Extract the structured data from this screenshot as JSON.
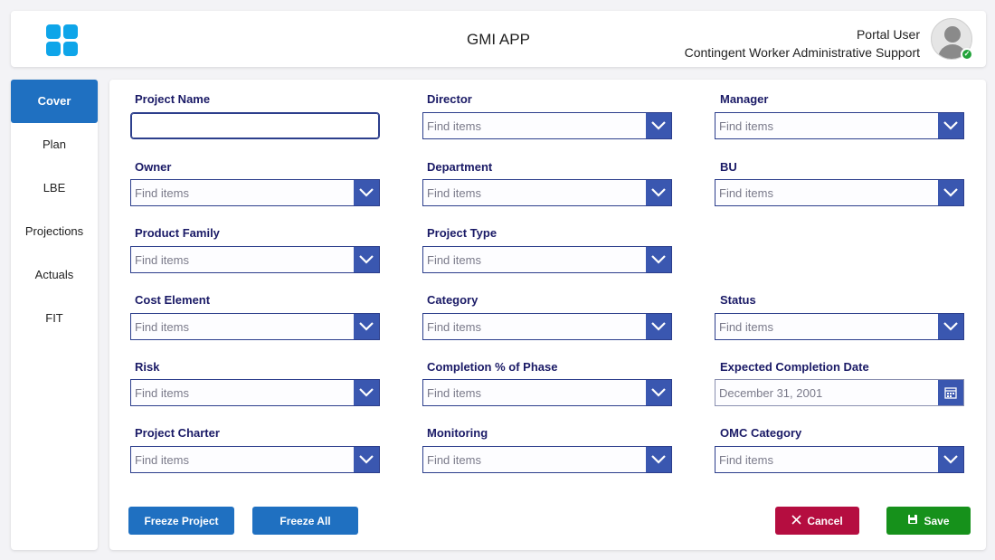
{
  "header": {
    "app_title": "GMI APP",
    "user_name": "Portal User",
    "user_role": "Contingent Worker Administrative Support"
  },
  "sidebar": {
    "items": [
      {
        "label": "Cover",
        "active": true
      },
      {
        "label": "Plan"
      },
      {
        "label": "LBE"
      },
      {
        "label": "Projections"
      },
      {
        "label": "Actuals"
      },
      {
        "label": "FIT"
      }
    ]
  },
  "form": {
    "project_name": {
      "label": "Project Name",
      "value": ""
    },
    "director": {
      "label": "Director",
      "placeholder": "Find items"
    },
    "manager": {
      "label": "Manager",
      "placeholder": "Find items"
    },
    "owner": {
      "label": "Owner",
      "placeholder": "Find items"
    },
    "department": {
      "label": "Department",
      "placeholder": "Find items"
    },
    "bu": {
      "label": "BU",
      "placeholder": "Find items"
    },
    "product_family": {
      "label": "Product Family",
      "placeholder": "Find items"
    },
    "project_type": {
      "label": "Project Type",
      "placeholder": "Find items"
    },
    "cost_element": {
      "label": "Cost Element",
      "placeholder": "Find items"
    },
    "category": {
      "label": "Category",
      "placeholder": "Find items"
    },
    "status": {
      "label": "Status",
      "placeholder": "Find items"
    },
    "risk": {
      "label": "Risk",
      "placeholder": "Find items"
    },
    "completion_phase": {
      "label": "Completion % of Phase",
      "placeholder": "Find items"
    },
    "expected_completion_date": {
      "label": "Expected Completion Date",
      "value": "December 31, 2001"
    },
    "project_charter": {
      "label": "Project Charter",
      "placeholder": "Find items"
    },
    "monitoring": {
      "label": "Monitoring",
      "placeholder": "Find items"
    },
    "omc_category": {
      "label": "OMC Category",
      "placeholder": "Find items"
    }
  },
  "actions": {
    "freeze_project": "Freeze Project",
    "freeze_all": "Freeze All",
    "cancel": "Cancel",
    "save": "Save"
  },
  "colors": {
    "primary": "#1f70c1",
    "dropdown": "#3a57b0",
    "label": "#1a1a66",
    "cancel": "#b50d40",
    "save": "#16911b",
    "logo": "#0ea5e9"
  }
}
